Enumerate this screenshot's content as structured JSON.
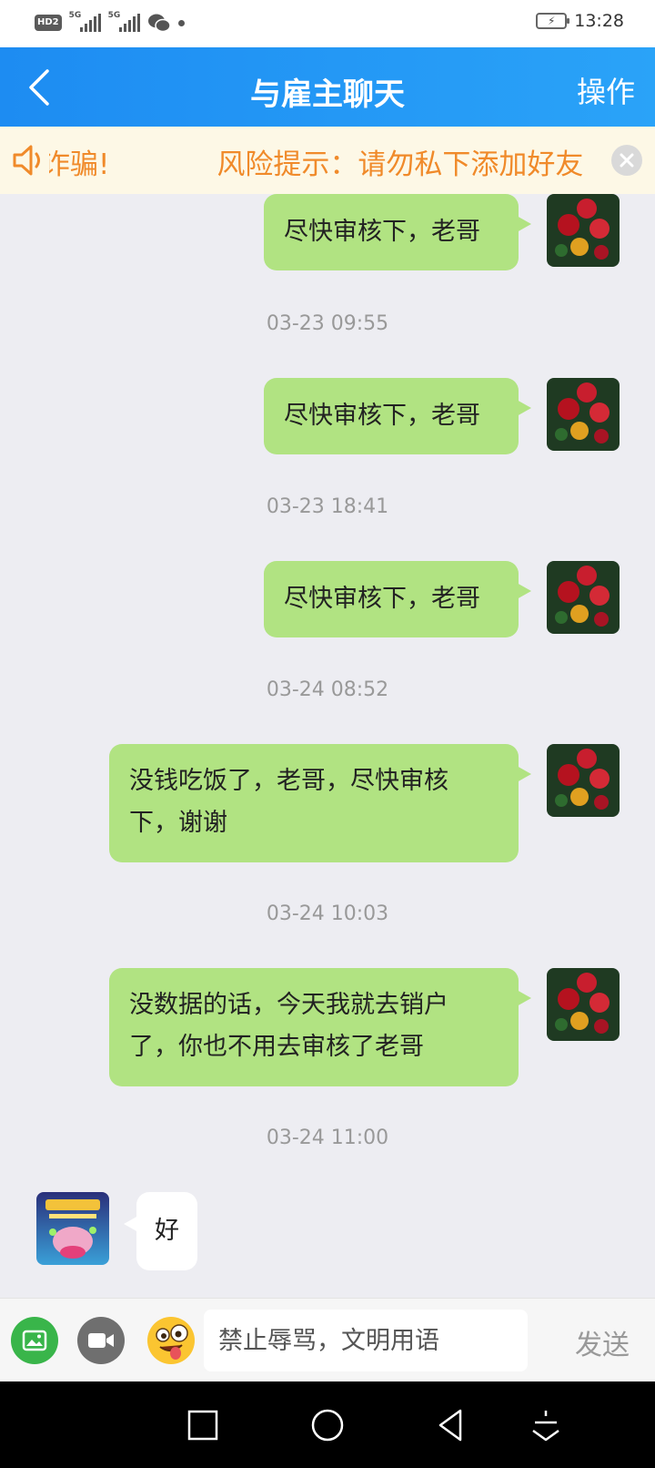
{
  "status_bar": {
    "hd_badge": "HD2",
    "network_1": "5G",
    "network_2": "5G",
    "time": "13:28"
  },
  "header": {
    "title": "与雇主聊天",
    "action_label": "操作"
  },
  "notice": {
    "text_fragment": "诈骗!",
    "text_main": "风险提示：请勿私下添加好友"
  },
  "messages": [
    {
      "side": "right",
      "text": "尽快审核下，老哥"
    },
    {
      "timestamp": "03-23 09:55"
    },
    {
      "side": "right",
      "text": "尽快审核下，老哥"
    },
    {
      "timestamp": "03-23 18:41"
    },
    {
      "side": "right",
      "text": "尽快审核下，老哥"
    },
    {
      "timestamp": "03-24 08:52"
    },
    {
      "side": "right",
      "text_line1": "没钱吃饭了，老哥，尽快审核",
      "text_line2": "下，谢谢"
    },
    {
      "timestamp": "03-24 10:03"
    },
    {
      "side": "right",
      "text_line1": "没数据的话，今天我就去销户",
      "text_line2": "了，你也不用去审核了老哥"
    },
    {
      "timestamp": "03-24 11:00"
    },
    {
      "side": "left",
      "text": "好"
    }
  ],
  "input_bar": {
    "placeholder": "禁止辱骂，文明用语",
    "send_label": "发送"
  },
  "colors": {
    "header": "#1d8cf2",
    "bubble_mine": "#b1e382",
    "notice_text": "#f08a2a",
    "background": "#ededf2"
  },
  "icons": [
    "back-arrow-icon",
    "speaker-icon",
    "close-icon",
    "image-icon",
    "video-icon",
    "emoji-icon",
    "nav-square-icon",
    "nav-circle-icon",
    "nav-back-icon",
    "nav-hide-icon"
  ]
}
